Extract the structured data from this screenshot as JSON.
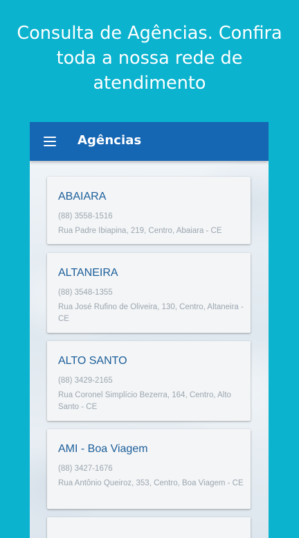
{
  "promo": {
    "line1": "Consulta de Agências. Confira",
    "line2": "toda a nossa rede de",
    "line3": "atendimento"
  },
  "colors": {
    "background": "#0bb3cf",
    "appbar": "#1566b3",
    "agency_name": "#1a5e9a",
    "secondary_text": "#9aa6b1",
    "card": "#f4f5f6"
  },
  "appbar": {
    "menu_icon": "hamburger-menu-icon",
    "title": "Agências"
  },
  "agencies": [
    {
      "name": "ABAIARA",
      "phone": "(88) 3558-1516",
      "address": "Rua Padre Ibiapina, 219, Centro, Abaiara - CE"
    },
    {
      "name": "ALTANEIRA",
      "phone": "(88) 3548-1355",
      "address": "Rua José Rufino de Oliveira, 130, Centro, Altaneira - CE"
    },
    {
      "name": "ALTO SANTO",
      "phone": "(88) 3429-2165",
      "address": "Rua Coronel Simplício Bezerra, 164, Centro, Alto Santo - CE"
    },
    {
      "name": "AMI - Boa Viagem",
      "phone": "(88) 3427-1676",
      "address": "Rua Antônio Queiroz, 353, Centro, Boa Viagem - CE"
    },
    {
      "name": "",
      "phone": "",
      "address": ""
    }
  ]
}
